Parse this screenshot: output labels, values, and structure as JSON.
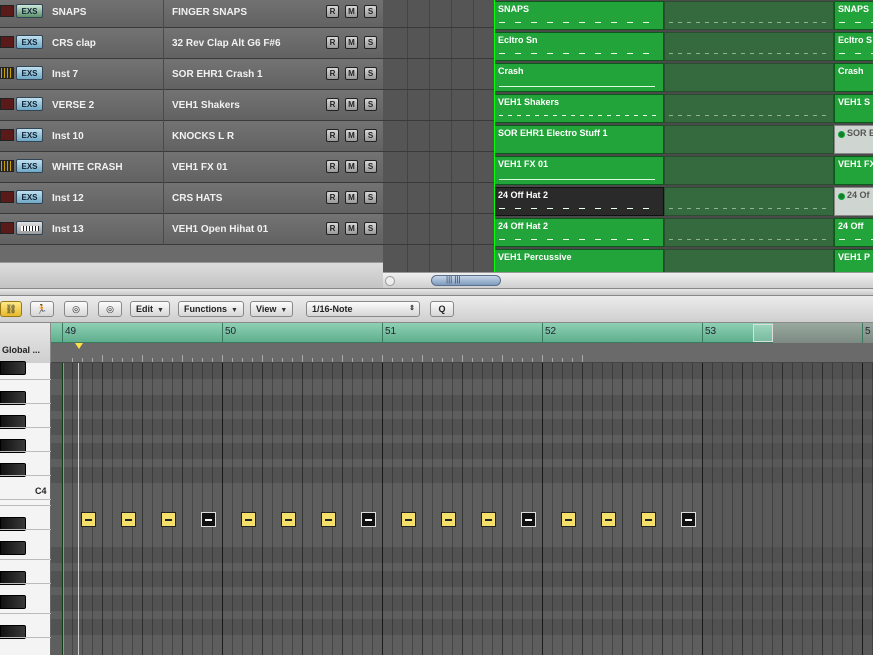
{
  "tracks": [
    {
      "icon": "EXS",
      "name": "SNAPS",
      "instrument": "FINGER SNAPS",
      "r": "R",
      "m": "M",
      "s": "S"
    },
    {
      "icon": "EXS",
      "name": "CRS clap",
      "instrument": "32 Rev Clap Alt G6 F#6",
      "r": "R",
      "m": "M",
      "s": "S"
    },
    {
      "icon": "EXS",
      "name": "Inst 7",
      "instrument": "SOR EHR1 Crash 1",
      "r": "R",
      "m": "M",
      "s": "S"
    },
    {
      "icon": "EXS",
      "name": "VERSE 2",
      "instrument": "VEH1 Shakers",
      "r": "R",
      "m": "M",
      "s": "S"
    },
    {
      "icon": "EXS",
      "name": "Inst 10",
      "instrument": "KNOCKS L R",
      "r": "R",
      "m": "M",
      "s": "S"
    },
    {
      "icon": "EXS",
      "name": "WHITE CRASH",
      "instrument": "VEH1 FX 01",
      "r": "R",
      "m": "M",
      "s": "S"
    },
    {
      "icon": "EXS",
      "name": "Inst 12",
      "instrument": "CRS HATS",
      "r": "R",
      "m": "M",
      "s": "S"
    },
    {
      "icon": "",
      "name": "Inst 13",
      "instrument": "VEH1 Open Hihat 01",
      "r": "R",
      "m": "M",
      "s": "S"
    }
  ],
  "regions": {
    "main": [
      "SNAPS",
      "Ecltro Sn",
      "Crash",
      "VEH1 Shakers",
      "SOR EHR1 Electro Stuff 1",
      "VEH1 FX 01",
      "24 Off Hat 2",
      "24 Off Hat 2",
      "VEH1 Percussive"
    ],
    "right": [
      "SNAPS",
      "Ecltro S",
      "Crash",
      "VEH1 S",
      "SOR E",
      "VEH1 FX",
      "24 Of",
      "24 Off",
      "VEH1 P"
    ]
  },
  "toolbar": {
    "edit": "Edit",
    "functions": "Functions",
    "view": "View",
    "quantize": "1/16-Note",
    "q": "Q"
  },
  "pianoroll": {
    "header": "Global ...",
    "bars": [
      "49",
      "50",
      "51",
      "52",
      "53",
      "5"
    ],
    "key_label": "C4"
  },
  "colors": {
    "region_green": "#22a43a",
    "ruler_green": "#6fbf9c",
    "note_yellow": "#f4e06a",
    "playhead": "#2fd04a"
  }
}
